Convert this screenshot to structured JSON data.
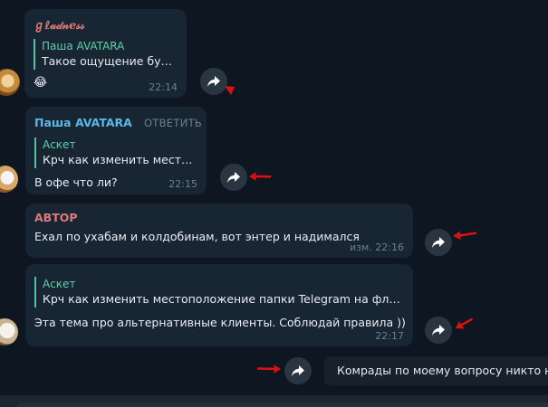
{
  "messages": [
    {
      "author": "ℊℓ𝒶𝒹𝓃ℯ𝓈𝓈",
      "author_color": "#e07a7a",
      "reply_name": "Паша AVATARA",
      "reply_text": "Такое ощущение буд...",
      "text": "😂",
      "time": "22:14"
    },
    {
      "author": "Паша AVATARA",
      "author_color": "#59b9e6",
      "reply_action": "ОТВЕТИТЬ",
      "reply_name": "Аскет",
      "reply_text": "Крч как изменить место...",
      "text": "В офе что ли?",
      "time": "22:15"
    },
    {
      "author": "АВТОР",
      "author_color": "#e07a7a",
      "text": "Ехал по ухабам и колдобинам, вот энтер и надимался",
      "time": "изм. 22:16"
    },
    {
      "reply_name": "Аскет",
      "reply_text": "Крч как изменить местоположение папки Telegram на флешу...",
      "text": "Эта тема про альтернативные клиенты. Соблюдай правила ))",
      "time": "22:17"
    }
  ],
  "input": {
    "value": "Комрады по моему вопросу никто не"
  },
  "icons": {
    "forward": "forward-share-icon",
    "annotation": "red-arrow-icon"
  },
  "colors": {
    "background": "#0e1621",
    "bubble": "#182533",
    "reply_accent": "#4fc3a1",
    "annotation": "#e01010"
  }
}
